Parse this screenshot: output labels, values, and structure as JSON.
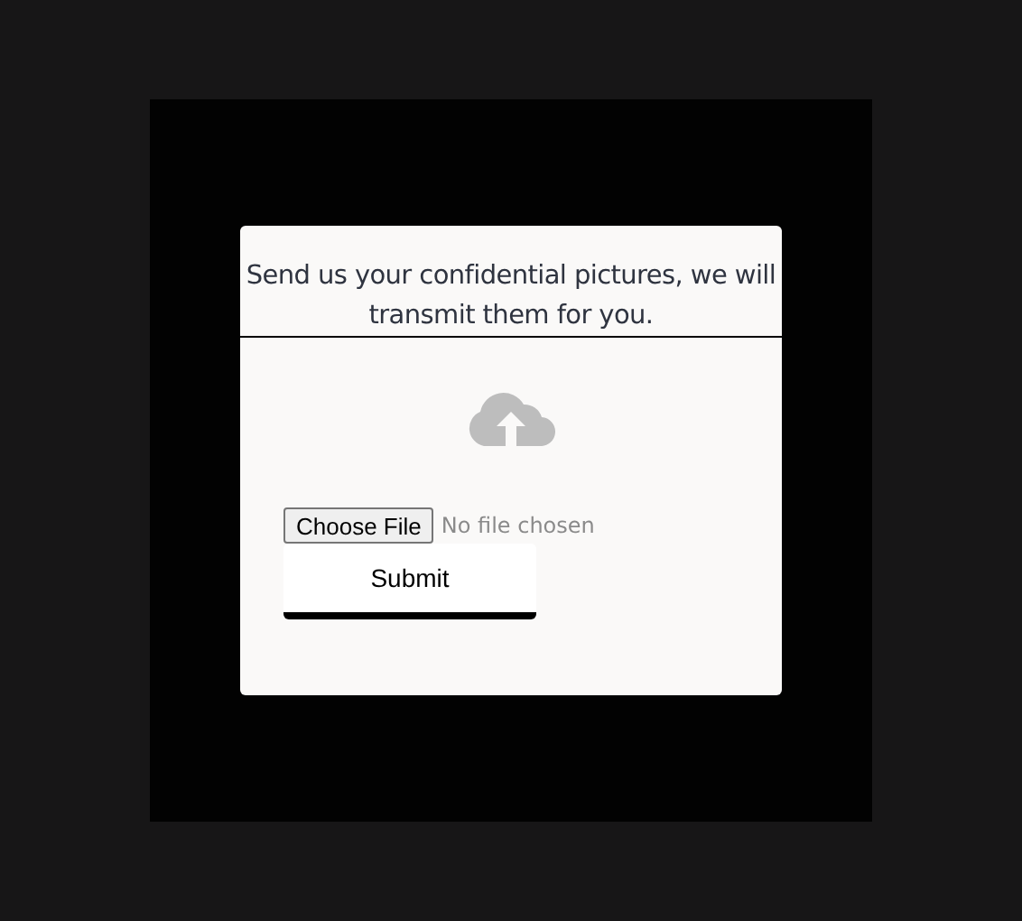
{
  "form": {
    "heading": "Send us your confidential pictures, we will transmit them for you.",
    "file_input": {
      "button": "Choose File",
      "status": "No file chosen"
    },
    "submit": "Submit"
  }
}
